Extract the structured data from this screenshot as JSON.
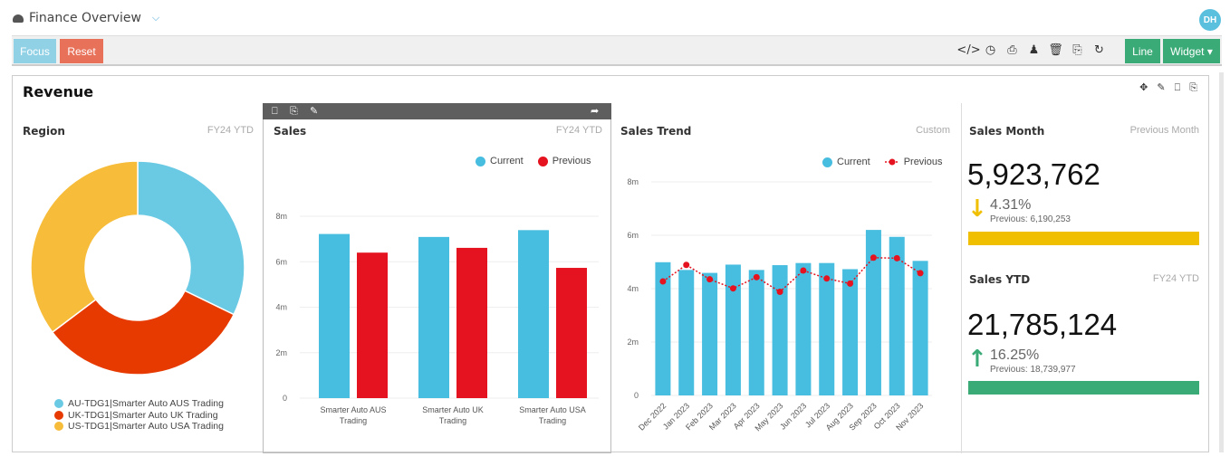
{
  "app": {
    "title": "Finance Overview",
    "user_initials": "DH"
  },
  "toolbar": {
    "focus_label": "Focus",
    "reset_label": "Reset",
    "line_label": "Line",
    "widget_label": "Widget ▾",
    "icons": [
      "code-icon",
      "history-icon",
      "print-icon",
      "users-icon",
      "trash-icon",
      "copy-icon",
      "refresh-icon"
    ]
  },
  "dashboard": {
    "title": "Revenue",
    "icons": [
      "move-icon",
      "edit-icon",
      "trash-icon",
      "copy-icon"
    ]
  },
  "colors": {
    "current": "#47bddf",
    "previous": "#e5131f",
    "aus": "#6ac9e3",
    "uk": "#e63a00",
    "usa": "#f6bc3a",
    "down": "#f0c000",
    "up": "#3aaa77"
  },
  "region_panel": {
    "title": "Region",
    "period": "FY24 YTD",
    "legend": [
      "AU-TDG1|Smarter Auto AUS Trading",
      "UK-TDG1|Smarter Auto UK Trading",
      "US-TDG1|Smarter Auto USA Trading"
    ]
  },
  "sales_panel": {
    "title": "Sales",
    "period": "FY24 YTD",
    "legend_current": "Current",
    "legend_previous": "Previous"
  },
  "trend_panel": {
    "title": "Sales Trend",
    "period": "Custom",
    "legend_current": "Current",
    "legend_previous": "Previous"
  },
  "sales_month": {
    "title": "Sales Month",
    "period": "Previous Month",
    "value": "5,923,762",
    "change": "4.31%",
    "direction": "down",
    "previous": "Previous: 6,190,253"
  },
  "sales_ytd": {
    "title": "Sales YTD",
    "period": "FY24 YTD",
    "value": "21,785,124",
    "change": "16.25%",
    "direction": "up",
    "previous": "Previous: 18,739,977"
  },
  "chart_data": [
    {
      "type": "pie",
      "title": "Region",
      "donut": true,
      "categories": [
        "AU-TDG1|Smarter Auto AUS Trading",
        "UK-TDG1|Smarter Auto UK Trading",
        "US-TDG1|Smarter Auto USA Trading"
      ],
      "values": [
        32.2,
        32.5,
        35.3
      ],
      "legend": "bottom"
    },
    {
      "type": "bar",
      "title": "Sales",
      "categories": [
        "Smarter Auto AUS Trading",
        "Smarter Auto UK Trading",
        "Smarter Auto USA Trading"
      ],
      "series": [
        {
          "name": "Current",
          "values": [
            7.22,
            7.09,
            7.39
          ]
        },
        {
          "name": "Previous",
          "values": [
            6.4,
            6.61,
            5.73
          ]
        }
      ],
      "ylabel": "",
      "ylim": [
        0,
        8
      ],
      "yticks": [
        "0",
        "2m",
        "4m",
        "6m",
        "8m"
      ],
      "unit": "m",
      "grid": true,
      "legend": "top-right"
    },
    {
      "type": "bar",
      "title": "Sales Trend",
      "categories": [
        "Dec 2022",
        "Jan 2023",
        "Feb 2023",
        "Mar 2023",
        "Apr 2023",
        "May 2023",
        "Jun 2023",
        "Jul 2023",
        "Aug 2023",
        "Sep 2023",
        "Oct 2023",
        "Nov 2023"
      ],
      "series": [
        {
          "name": "Current",
          "type": "bar",
          "values": [
            4.99,
            4.7,
            4.59,
            4.9,
            4.7,
            4.88,
            4.96,
            4.96,
            4.73,
            6.2,
            5.94,
            5.04
          ]
        },
        {
          "name": "Previous",
          "type": "line",
          "values": [
            4.27,
            4.89,
            4.35,
            4.01,
            4.43,
            3.88,
            4.68,
            4.38,
            4.19,
            5.16,
            5.14,
            4.58
          ]
        }
      ],
      "ylim": [
        0,
        8
      ],
      "yticks": [
        "0",
        "2m",
        "4m",
        "6m",
        "8m"
      ],
      "unit": "m",
      "grid": true,
      "legend": "top-right"
    }
  ]
}
